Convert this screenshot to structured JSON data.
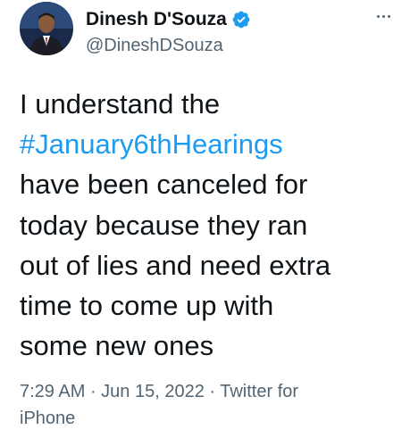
{
  "tweet": {
    "display_name": "Dinesh D'Souza",
    "handle": "@DineshDSouza",
    "verified_icon": "verified-badge-icon",
    "more_icon": "more-options-icon",
    "body": {
      "line1": "I understand the",
      "hashtag": "#January6thHearings",
      "line3": "have been canceled for",
      "line4": "today because they ran",
      "line5": "out of lies and need extra",
      "line6": "time to come up with",
      "line7": "some new ones"
    },
    "meta": {
      "time": "7:29 AM",
      "sep1": " · ",
      "date": "Jun 15, 2022",
      "sep2": " · ",
      "source_prefix": "Twitter for",
      "source_suffix": "iPhone"
    }
  },
  "colors": {
    "text": "#0f1419",
    "secondary": "#536471",
    "link": "#1d9bf0",
    "verified": "#1d9bf0"
  }
}
